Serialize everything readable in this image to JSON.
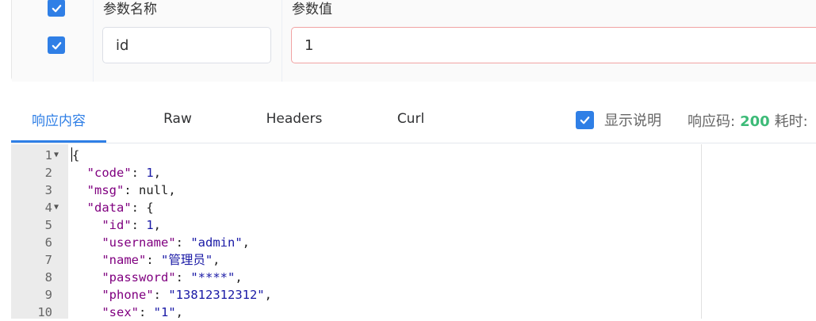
{
  "params": {
    "col_name_header": "参数名称",
    "col_value_header": "参数值",
    "row": {
      "name": "id",
      "value": "1"
    }
  },
  "response_tabs": [
    {
      "label": "响应内容",
      "active": true
    },
    {
      "label": "Raw",
      "active": false
    },
    {
      "label": "Headers",
      "active": false
    },
    {
      "label": "Curl",
      "active": false
    }
  ],
  "show_description_label": "显示说明",
  "status_label": "响应码:",
  "status_code": "200",
  "time_label": "耗时:",
  "code_lines": [
    {
      "n": "1",
      "fold": true,
      "text": "{"
    },
    {
      "n": "2",
      "fold": false,
      "text": "  \"code\": 1,"
    },
    {
      "n": "3",
      "fold": false,
      "text": "  \"msg\": null,"
    },
    {
      "n": "4",
      "fold": true,
      "text": "  \"data\": {"
    },
    {
      "n": "5",
      "fold": false,
      "text": "    \"id\": 1,"
    },
    {
      "n": "6",
      "fold": false,
      "text": "    \"username\": \"admin\","
    },
    {
      "n": "7",
      "fold": false,
      "text": "    \"name\": \"管理员\","
    },
    {
      "n": "8",
      "fold": false,
      "text": "    \"password\": \"****\","
    },
    {
      "n": "9",
      "fold": false,
      "text": "    \"phone\": \"13812312312\","
    },
    {
      "n": "10",
      "fold": false,
      "text": "    \"sex\": \"1\","
    }
  ],
  "colors": {
    "accent": "#2f7fe6",
    "status_ok": "#3dbb78",
    "key": "#800080",
    "string": "#1a1aa6"
  }
}
